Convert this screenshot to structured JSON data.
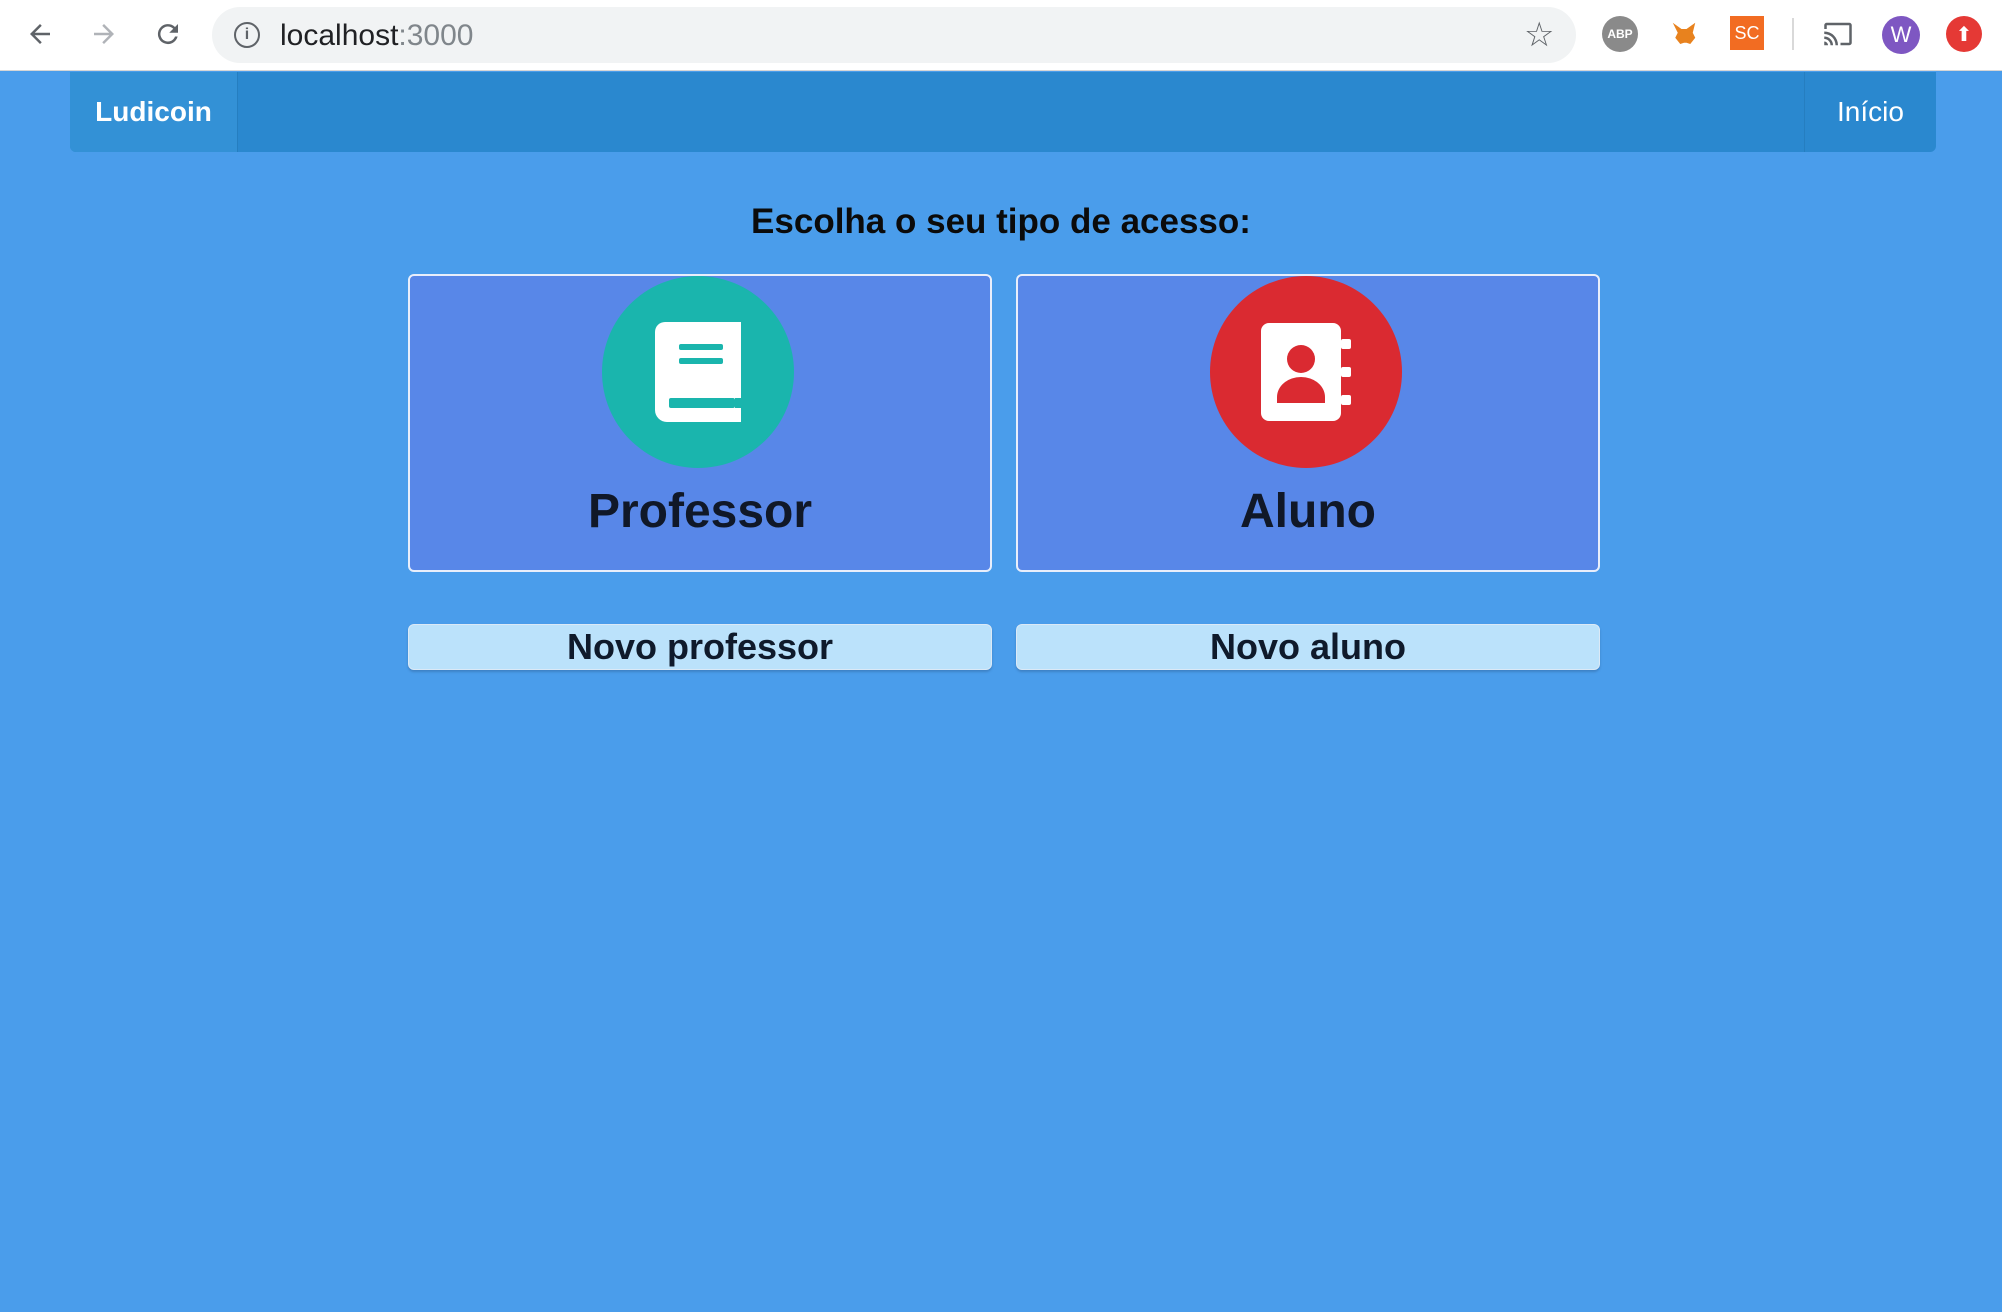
{
  "browser": {
    "url_host": "localhost",
    "url_port": ":3000",
    "extensions": {
      "abp": "ABP",
      "sc": "SC",
      "avatar": "W"
    }
  },
  "navbar": {
    "brand": "Ludicoin",
    "home_link": "Início"
  },
  "main": {
    "heading": "Escolha o seu tipo de acesso:",
    "cards": [
      {
        "label": "Professor",
        "icon": "book-icon",
        "color": "#1ab5ad"
      },
      {
        "label": "Aluno",
        "icon": "address-book-icon",
        "color": "#da2a31"
      }
    ],
    "buttons": [
      {
        "label": "Novo professor"
      },
      {
        "label": "Novo aluno"
      }
    ]
  },
  "colors": {
    "background": "#4a9deb",
    "navbar": "#2a88cf",
    "card": "#5887e8",
    "button": "#bbe2fb"
  }
}
